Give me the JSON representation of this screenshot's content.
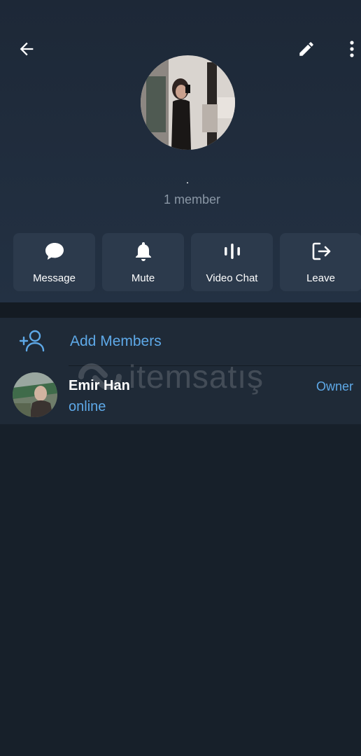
{
  "header": {
    "back_icon": "arrow-left-icon",
    "edit_icon": "pencil-icon",
    "more_icon": "more-vertical-icon",
    "group_name": ".",
    "member_count": "1 member"
  },
  "actions": [
    {
      "label": "Message",
      "icon": "chat-bubble-icon"
    },
    {
      "label": "Mute",
      "icon": "bell-icon"
    },
    {
      "label": "Video Chat",
      "icon": "voice-bars-icon"
    },
    {
      "label": "Leave",
      "icon": "leave-icon"
    }
  ],
  "members_section": {
    "add_label": "Add Members",
    "add_icon": "add-user-icon",
    "members": [
      {
        "name": "Emir Han",
        "status": "online",
        "role": "Owner"
      }
    ]
  },
  "watermark": {
    "text": "itemsatış"
  },
  "colors": {
    "accent": "#5ea9e8",
    "header_bg": "#233143",
    "button_bg": "#2c3a4c",
    "body_bg": "#17202a"
  }
}
